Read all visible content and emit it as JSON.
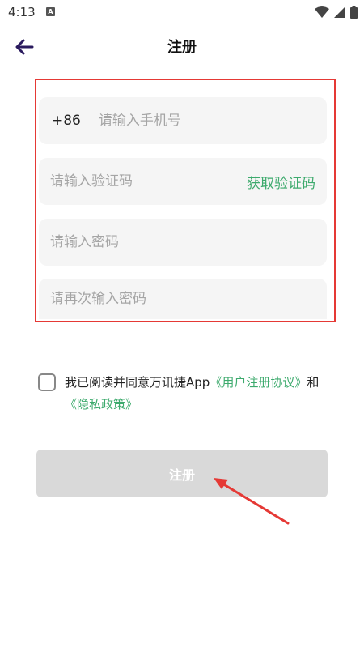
{
  "status_bar": {
    "time": "4:13",
    "notification_badge": "A"
  },
  "header": {
    "title": "注册"
  },
  "form": {
    "phone_prefix": "+86",
    "phone_placeholder": "请输入手机号",
    "code_placeholder": "请输入验证码",
    "get_code_label": "获取验证码",
    "password_placeholder": "请输入密码",
    "confirm_password_placeholder": "请再次输入密码"
  },
  "agreement": {
    "text": "我已阅读并同意万讯捷App",
    "user_agreement_link": "《用户注册协议》",
    "and": "和",
    "privacy_link": "《隐私政策》"
  },
  "register_button": {
    "label": "注册"
  },
  "colors": {
    "accent_green": "#3daa6d",
    "annotation_red": "#e53935",
    "button_disabled": "#d9d9d9",
    "back_arrow": "#2a1a5e"
  }
}
